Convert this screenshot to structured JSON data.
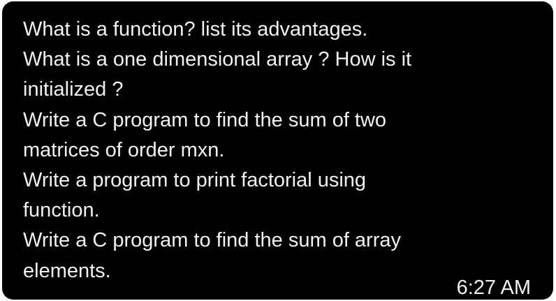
{
  "message": {
    "lines": [
      "What is a function? list its advantages.",
      "What is a one dimensional array ? How is it",
      "initialized ?",
      "Write a C program to find the sum of two",
      "matrices of order mxn.",
      "Write a program to print factorial using",
      "function.",
      "Write a C program to find the sum of array",
      "elements."
    ],
    "timestamp": "6:27 AM"
  },
  "colors": {
    "bubble_background": "#000000",
    "text": "#f1f1f1",
    "page_background": "#ffffff"
  }
}
